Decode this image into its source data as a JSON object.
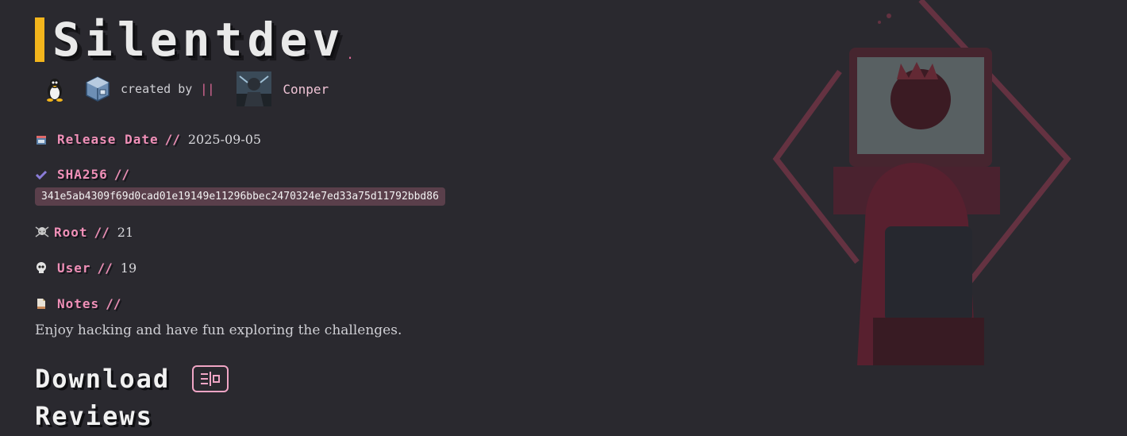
{
  "header": {
    "title": "Silentdev",
    "title_suffix": ".",
    "created_by_label": "created by",
    "separator": "||",
    "author_name": "Conper",
    "os_icon": "linux-penguin-icon",
    "platform_icon": "virtualbox-icon"
  },
  "fields": {
    "release_label": "Release Date",
    "release_value": "2025-09-05",
    "sha_label": "SHA256",
    "sha_value": "341e5ab4309f69d0cad01e19149e11296bbec2470324e7ed33a75d11792bbd86",
    "root_label": "Root",
    "root_value": "21",
    "user_label": "User",
    "user_value": "19",
    "notes_label": "Notes",
    "notes_value": "Enjoy hacking and have fun exploring the challenges.",
    "slashes": "//"
  },
  "sections": {
    "download": "Download",
    "reviews": "Reviews"
  },
  "colors": {
    "accent": "#f3b51c",
    "pink": "#f090b8",
    "background": "#2a292f"
  }
}
